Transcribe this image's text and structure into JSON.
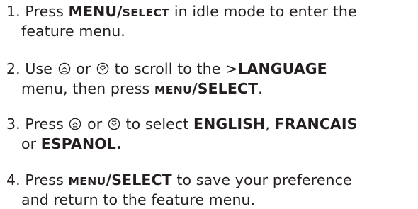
{
  "instructions": [
    {
      "number": "1.",
      "line1": {
        "pre": "Press ",
        "key_a": "MENU/",
        "key_b": "SELECT",
        "post": " in idle mode to enter the"
      },
      "line2": "feature menu."
    },
    {
      "number": "2.",
      "line1": {
        "pre": "Use ",
        "mid": " or ",
        "post": " to scroll to the >",
        "menu": "LANGUAGE"
      },
      "line2": {
        "pre": "menu, then press ",
        "key_a": "MENU",
        "key_b": "/SELECT",
        "post": "."
      }
    },
    {
      "number": "3.",
      "line1": {
        "pre": "Press ",
        "mid": " or ",
        "post": " to select ",
        "opt1": "ENGLISH",
        "sep": ", ",
        "opt2": "FRANCAIS"
      },
      "line2": {
        "pre": "or ",
        "opt3": "ESPANOL."
      }
    },
    {
      "number": "4.",
      "line1": {
        "pre": "Press ",
        "key_a": "MENU",
        "key_b": "/SELECT",
        "post": " to save your preference"
      },
      "line2": "and return to the feature menu."
    }
  ],
  "icons": {
    "scroll_up": "scroll-up-icon",
    "scroll_down": "scroll-down-icon"
  }
}
